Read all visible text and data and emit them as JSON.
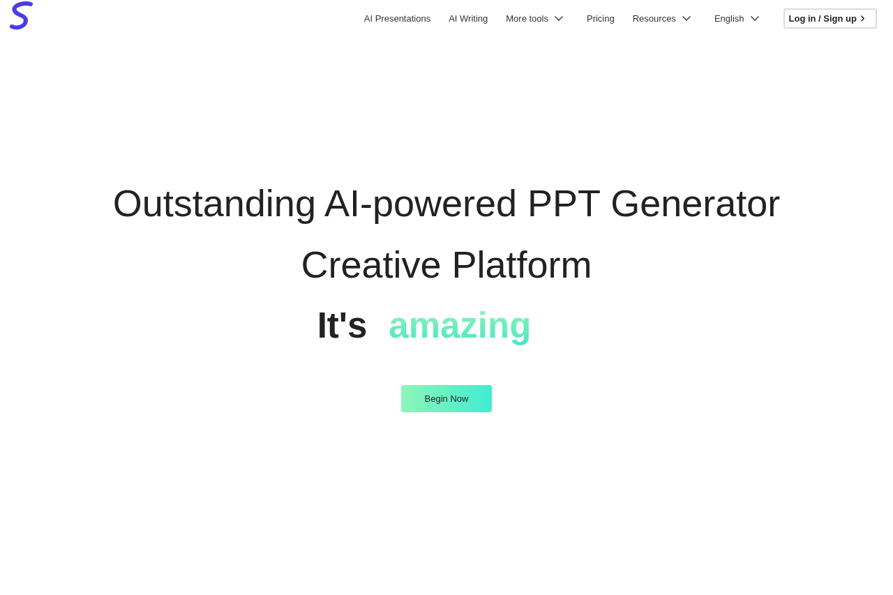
{
  "nav": {
    "items": [
      {
        "label": "AI Presentations",
        "dropdown": false
      },
      {
        "label": "AI Writing",
        "dropdown": false
      },
      {
        "label": "More tools",
        "dropdown": true
      },
      {
        "label": "Pricing",
        "dropdown": false
      },
      {
        "label": "Resources",
        "dropdown": true
      },
      {
        "label": "English",
        "dropdown": true
      }
    ],
    "login_button": "Log in / Sign up"
  },
  "hero": {
    "title_lines": [
      "Outstanding AI-powered PPT Generator",
      "Creative Platform"
    ],
    "tagline": {
      "lead": "It's",
      "highlight": "amazing"
    },
    "cta_button": "Begin Now"
  }
}
